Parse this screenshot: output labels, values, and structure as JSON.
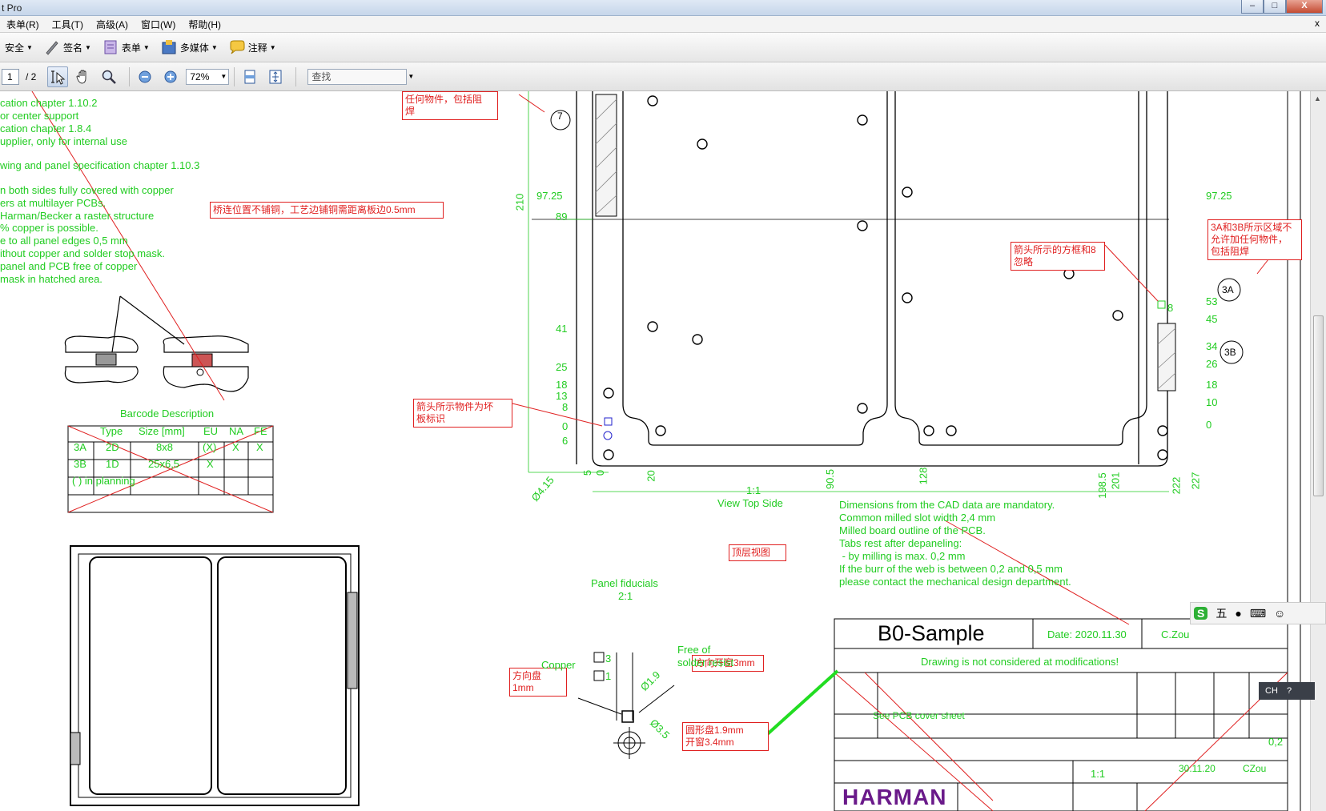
{
  "window": {
    "title": "t Pro",
    "btn_min": "–",
    "btn_max": "□",
    "btn_close": "X",
    "doc_close": "x"
  },
  "menu": [
    "表单(R)",
    "工具(T)",
    "高级(A)",
    "窗口(W)",
    "帮助(H)"
  ],
  "toolbar1": {
    "security": "安全",
    "sign": "签名",
    "forms": "表单",
    "multimedia": "多媒体",
    "comment": "注释"
  },
  "toolbar2": {
    "page_current": "1",
    "page_total": "/ 2",
    "zoom": "72%",
    "find_placeholder": "查找"
  },
  "spec_text": [
    "cation chapter 1.10.2",
    "or center support",
    "cation chapter 1.8.4",
    "upplier, only for internal use",
    "wing and panel specification chapter 1.10.3",
    "n both sides fully covered with copper",
    "ers at multilayer PCBs.",
    "Harman/Becker a raster structure",
    "% copper is possible.",
    "e to all panel edges 0,5 mm",
    "ithout copper and solder stop mask.",
    "panel and PCB free of copper",
    "mask in hatched area."
  ],
  "annotations": {
    "a1": "任何物件，包括阻\n焊",
    "a2": "桥连位置不铺铜，工艺边铺铜需距离板边0.5mm",
    "a3": "箭头所示的方框和8\n忽略",
    "a4": "3A和3B所示区域不\n允许加任何物件，\n包括阻焊",
    "a5": "箭头所示物件为坏\n板标识",
    "a6": "顶层视图",
    "a7": "方向盘\n1mm",
    "a8": "方向开窗3mm",
    "a9": "圆形盘1.9mm\n开窗3.4mm"
  },
  "barcode": {
    "title": "Barcode Description",
    "headers": [
      "",
      "Type",
      "Size [mm]",
      "EU",
      "NA",
      "FE"
    ],
    "rows": [
      [
        "3A",
        "2D",
        "8x8",
        "(X)",
        "X",
        "X"
      ],
      [
        "3B",
        "1D",
        "25x6,5",
        "X",
        "",
        ""
      ]
    ],
    "footer": "( ) in planning"
  },
  "dims": {
    "y_left": [
      "97.25",
      "89",
      "41",
      "25",
      "18",
      "13",
      "8",
      "0",
      "6"
    ],
    "y_right": [
      "97.25",
      "53",
      "45",
      "34",
      "26",
      "18",
      "10",
      "0"
    ],
    "x": [
      "5",
      "0",
      "20",
      "90.5",
      "128",
      "198.5",
      "201",
      "222",
      "227"
    ],
    "vert": "210",
    "dia": "Ø4.15",
    "bubbles": [
      "7",
      "3A",
      "3B"
    ],
    "box8": "8"
  },
  "view": {
    "scale": "1:1",
    "label": "View Top Side"
  },
  "notes": [
    "Dimensions from the CAD data are mandatory.",
    "Common milled slot width 2,4 mm",
    "Milled board outline of the PCB.",
    "Tabs rest after depaneling:",
    " - by milling is max. 0,2 mm",
    "If the burr of the web is between 0,2 and 0,5 mm",
    "please contact the mechanical design department."
  ],
  "fiducials": {
    "title": "Panel fiducials",
    "scale": "2:1",
    "copper": "Copper",
    "free": "Free of\nsolder resist",
    "d19": "Ø1.9",
    "d35": "Ø3.5",
    "n3": "3",
    "n1": "1"
  },
  "titleblock": {
    "name": "B0-Sample",
    "date": "Date: 2020.11.30",
    "author": "C.Zou",
    "notice": "Drawing is not considered at modifications!",
    "material": "See PCB cover sheet",
    "value": "0,2",
    "brand": "HARMAN",
    "date2": "30.11.20",
    "author2": "CZou",
    "scale": "1:1"
  },
  "ime": {
    "label": "五",
    "ch": "CH"
  },
  "colors": {
    "annotation": "#22cc22",
    "markup": "#e02020",
    "arrow": "#22dd22"
  }
}
